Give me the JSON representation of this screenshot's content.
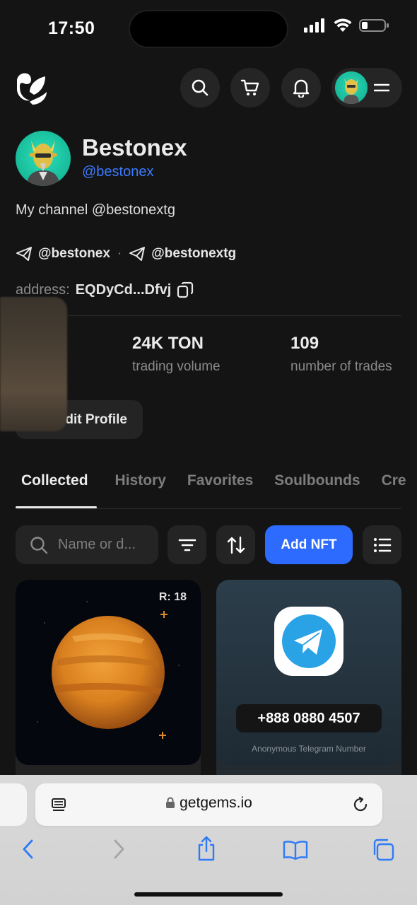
{
  "status_bar": {
    "time": "17:50"
  },
  "header": {
    "logo": "getgems-logo",
    "buttons": [
      "search-icon",
      "cart-icon",
      "bell-icon",
      "menu-icon"
    ]
  },
  "profile": {
    "name": "Bestonex",
    "handle": "@bestonex",
    "bio": "My channel @bestonextg",
    "links": [
      {
        "icon": "telegram-icon",
        "label": "@bestonex"
      },
      {
        "icon": "telegram-icon",
        "label": "@bestonextg"
      }
    ],
    "address_label": "address:",
    "address_value": "EQDyCd...Dfvj",
    "stats": [
      {
        "value": "24K TON",
        "label": "trading volume"
      },
      {
        "value": "109",
        "label": "number of trades"
      }
    ],
    "edit_label": "dit Profile"
  },
  "tabs": [
    {
      "label": "Collected",
      "active": true
    },
    {
      "label": "History",
      "active": false
    },
    {
      "label": "Favorites",
      "active": false
    },
    {
      "label": "Soulbounds",
      "active": false
    },
    {
      "label": "Cre",
      "active": false
    }
  ],
  "toolbar": {
    "search_placeholder": "Name or d...",
    "add_label": "Add NFT"
  },
  "cards": [
    {
      "rarity": "R: 18",
      "image": "orange-planet"
    },
    {
      "number": "+888 0880 4507",
      "caption": "Anonymous Telegram Number"
    }
  ],
  "browser": {
    "url": "getgems.io"
  },
  "colors": {
    "accent": "#2d6bff",
    "handle": "#3c7bff",
    "background": "#141414"
  }
}
